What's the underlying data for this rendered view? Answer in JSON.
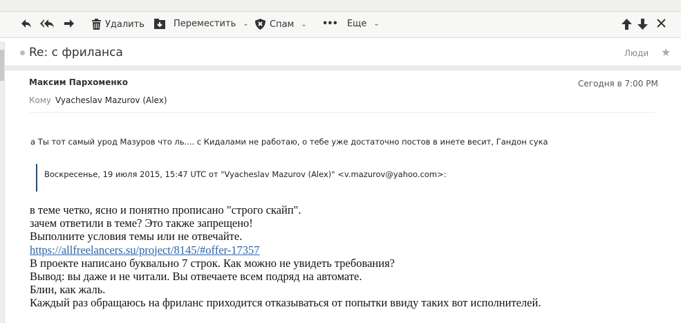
{
  "toolbar": {
    "reply": "reply",
    "delete_label": "Удалить",
    "move_label": "Переместить",
    "spam_label": "Спам",
    "more_label": "Еще"
  },
  "subject": {
    "title": "Re: с фриланса",
    "people_label": "Люди"
  },
  "message": {
    "sender": "Максим Пархоменко",
    "date": "Сегодня в 7:00 PM",
    "to_label": "Кому",
    "to_value": "Vyacheslav Mazurov (Alex)",
    "reply_text": "а Ты тот самый урод Мазуров что ль.... с Кидалами не работаю, о тебе уже достаточно постов в инете весит, Гандон сука",
    "quote_header": "Воскресенье, 19 июля 2015, 15:47 UTC от \"Vyacheslav Mazurov (Alex)\" <v.mazurov@yahoo.com>:",
    "quoted_lines": [
      "в теме четко, ясно и понятно прописано \"строго скайп\".",
      "зачем ответили в теме? Это также запрещено!",
      "Выполните условия темы или не отвечайте."
    ],
    "link": "https://allfreelancers.su/project/8145/#offer-17357",
    "quoted_lines_after": [
      "В проекте написано буквально 7 строк. Как можно не увидеть требования?",
      "Вывод: вы даже и не читали. Вы отвечаете всем подряд на автомате.",
      "Блин, как жаль.",
      "Каждый раз обращаюсь на фриланс приходится отказываться от попытки ввиду таких вот исполнителей."
    ]
  }
}
